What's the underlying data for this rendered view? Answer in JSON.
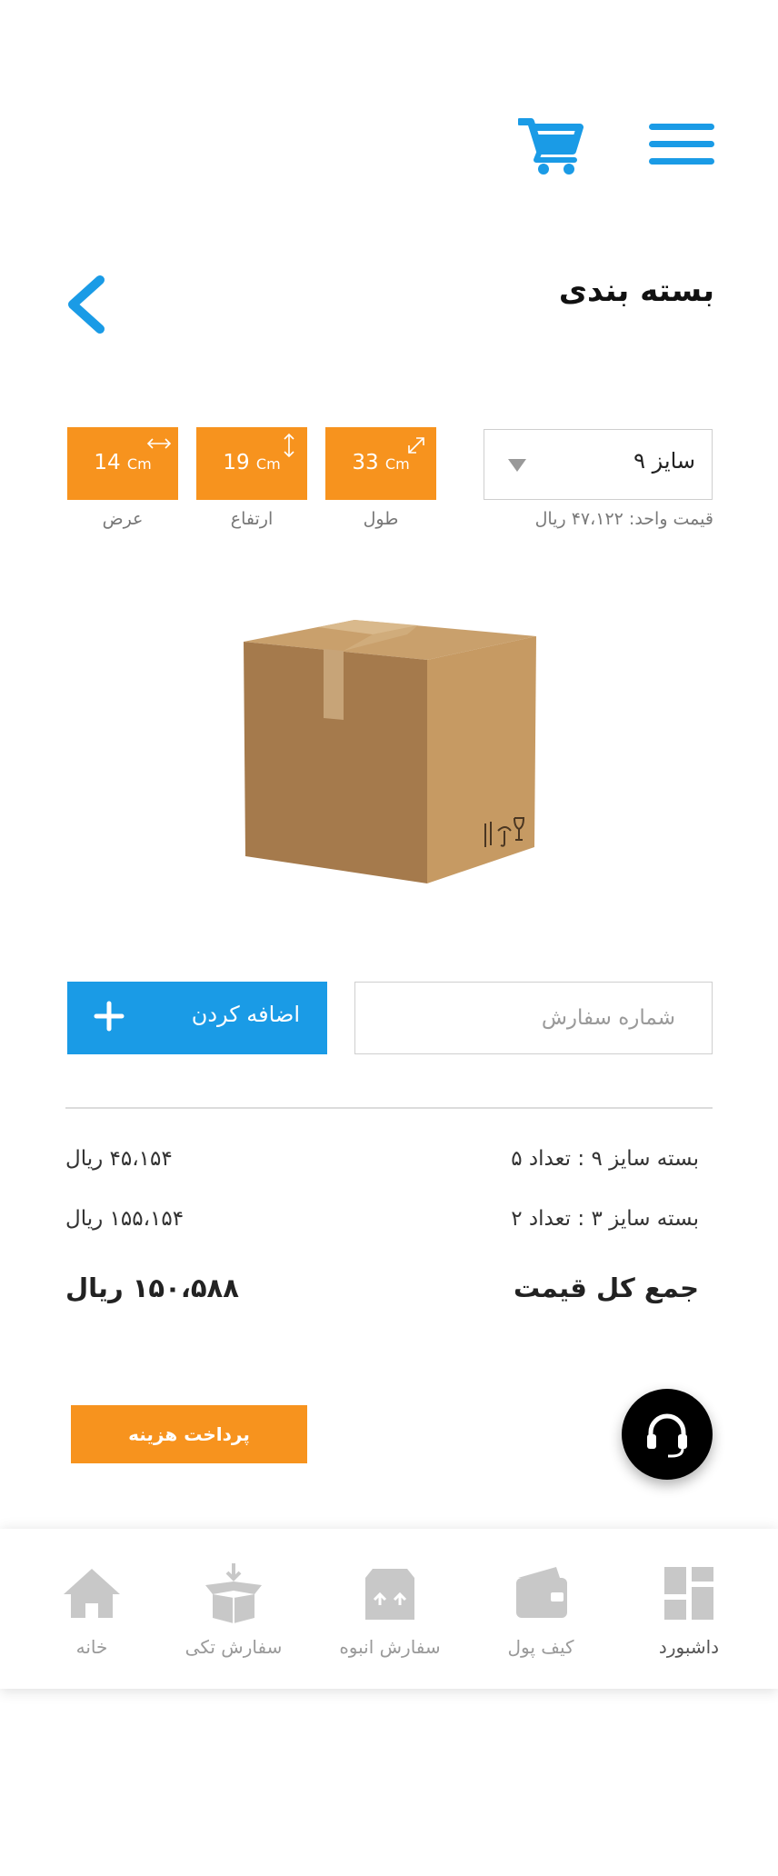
{
  "header": {
    "menu_icon": "hamburger-menu-icon",
    "cart_icon": "shopping-cart-icon",
    "title": "بسته بندی",
    "back_icon": "chevron-left-icon"
  },
  "product": {
    "size_selected": "سایز ۹",
    "unit_price": "قیمت واحد: ۴۷،۱۲۲ ریال",
    "dimensions": [
      {
        "value": "33",
        "unit": "Cm",
        "label": "طول",
        "icon": "diagonal-arrow-icon"
      },
      {
        "value": "19",
        "unit": "Cm",
        "label": "ارتفاع",
        "icon": "vertical-arrow-icon"
      },
      {
        "value": "14",
        "unit": "Cm",
        "label": "عرض",
        "icon": "horizontal-arrow-icon"
      }
    ]
  },
  "order": {
    "order_number_placeholder": "شماره سفارش",
    "add_label": "اضافه کردن",
    "lines": [
      {
        "desc": "بسته سایز ۹ : تعداد ۵",
        "price": "۴۵،۱۵۴ ریال"
      },
      {
        "desc": "بسته سایز ۳ : تعداد ۲",
        "price": "۱۵۵،۱۵۴ ریال"
      }
    ],
    "total_label": "جمع کل قیمت",
    "total_value": "۱۵۰،۵۸۸ ریال",
    "pay_label": "پرداخت هزینه"
  },
  "nav": [
    {
      "label": "داشبورد",
      "icon": "dashboard-icon"
    },
    {
      "label": "کیف پول",
      "icon": "wallet-icon"
    },
    {
      "label": "سفارش انبوه",
      "icon": "bulk-order-icon"
    },
    {
      "label": "سفارش تکی",
      "icon": "single-order-icon"
    },
    {
      "label": "خانه",
      "icon": "home-icon"
    }
  ],
  "colors": {
    "primary": "#1a9be6",
    "accent": "#f7931e",
    "nav_icon": "#c8c8c8"
  }
}
